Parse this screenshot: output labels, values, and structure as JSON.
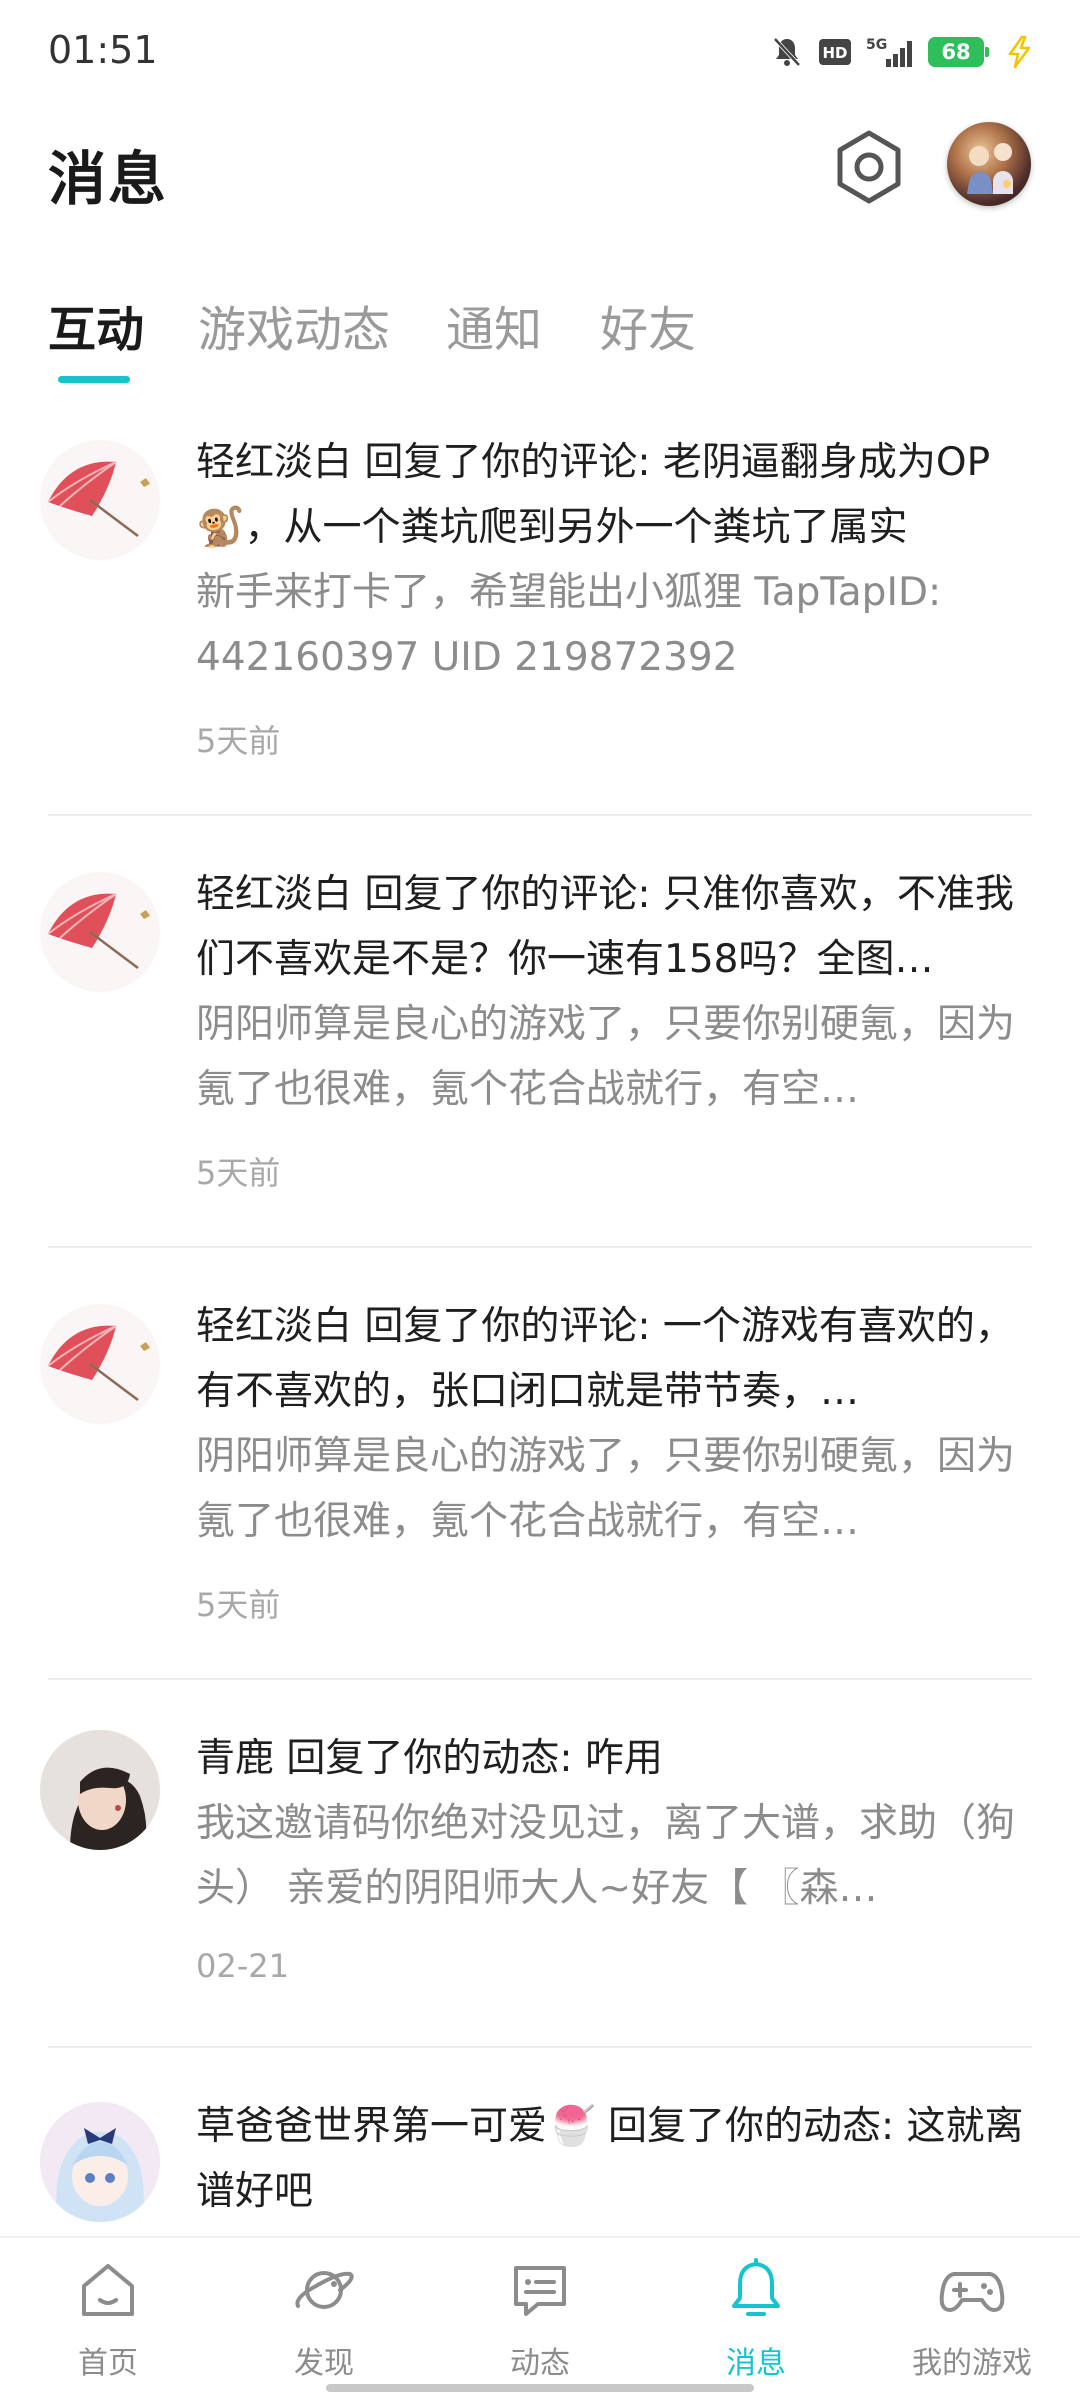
{
  "status_bar": {
    "time": "01:51",
    "icons": [
      "mute-bell-icon",
      "hd-icon",
      "5g-signal-icon",
      "battery-icon",
      "charging-icon"
    ],
    "network_label": "5G",
    "hd_label": "HD",
    "battery_level": "68"
  },
  "header": {
    "title": "消息",
    "settings_icon": "gear-icon",
    "avatar_icon": "user-avatar"
  },
  "tabs": [
    {
      "label": "互动",
      "active": true
    },
    {
      "label": "游戏动态",
      "active": false
    },
    {
      "label": "通知",
      "active": false
    },
    {
      "label": "好友",
      "active": false
    }
  ],
  "messages": [
    {
      "title": "轻红淡白 回复了你的评论: 老阴逼翻身成为OP🐒，从一个粪坑爬到另外一个粪坑了属实",
      "excerpt": "新手来打卡了，希望能出小狐狸 TapTapID: 442160397 UID 219872392",
      "time": "5天前"
    },
    {
      "title": "轻红淡白 回复了你的评论: 只准你喜欢，不准我们不喜欢是不是？你一速有158吗？全图…",
      "excerpt": "阴阳师算是良心的游戏了，只要你别硬氪，因为氪了也很难，氪个花合战就行，有空…",
      "time": "5天前"
    },
    {
      "title": "轻红淡白 回复了你的评论: 一个游戏有喜欢的，有不喜欢的，张口闭口就是带节奏，…",
      "excerpt": "阴阳师算是良心的游戏了，只要你别硬氪，因为氪了也很难，氪个花合战就行，有空…",
      "time": "5天前"
    },
    {
      "title": "青鹿 回复了你的动态: 咋用",
      "excerpt": "我这邀请码你绝对没见过，离了大谱，求助（狗头） 亲爱的阴阳师大人~好友【 〖森…",
      "time": "02-21"
    },
    {
      "title": "草爸爸世界第一可爱🍧 回复了你的动态: 这就离谱好吧",
      "excerpt": "",
      "time": ""
    }
  ],
  "bottom_nav": [
    {
      "label": "首页",
      "icon": "home-icon",
      "active": false
    },
    {
      "label": "发现",
      "icon": "planet-icon",
      "active": false
    },
    {
      "label": "动态",
      "icon": "chat-icon",
      "active": false
    },
    {
      "label": "消息",
      "icon": "bell-icon",
      "active": true
    },
    {
      "label": "我的游戏",
      "icon": "gamepad-icon",
      "active": false
    }
  ],
  "colors": {
    "accent": "#15c5ce",
    "text_primary": "#1f1f1f",
    "text_secondary": "#8c8c8c",
    "divider": "#ececec"
  }
}
